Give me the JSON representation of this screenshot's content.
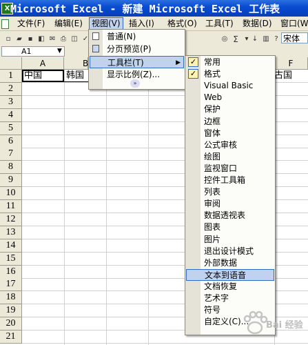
{
  "window": {
    "title": "Microsoft Excel - 新建 Microsoft Excel 工作表",
    "app_icon": "X"
  },
  "menubar": {
    "items": [
      {
        "label": "文件(F)"
      },
      {
        "label": "编辑(E)"
      },
      {
        "label": "视图(V)"
      },
      {
        "label": "插入(I)"
      },
      {
        "label": "格式(O)"
      },
      {
        "label": "工具(T)"
      },
      {
        "label": "数据(D)"
      },
      {
        "label": "窗口(W"
      }
    ]
  },
  "toolbar": {
    "font_name": "宋体",
    "sigma": "Σ"
  },
  "formula_bar": {
    "name_box": "A1"
  },
  "grid": {
    "columns": [
      "A",
      "B",
      "F"
    ],
    "rows": [
      "1",
      "2",
      "3",
      "4",
      "5",
      "6",
      "7",
      "8",
      "9",
      "10",
      "11",
      "12",
      "13",
      "14",
      "15",
      "16",
      "17",
      "18",
      "19",
      "20",
      "21"
    ],
    "cells": {
      "A1": "中国",
      "B1": "韩国",
      "F1": "古国"
    }
  },
  "view_menu": {
    "items": [
      {
        "label": "普通(N)"
      },
      {
        "label": "分页预览(P)"
      },
      {
        "label": "工具栏(T)"
      },
      {
        "label": "显示比例(Z)..."
      }
    ],
    "more": "»"
  },
  "toolbars_menu": {
    "check_mark": "✓",
    "items": [
      {
        "label": "常用",
        "checked": true
      },
      {
        "label": "格式",
        "checked": true
      },
      {
        "label": "Visual Basic",
        "checked": false
      },
      {
        "label": "Web",
        "checked": false
      },
      {
        "label": "保护",
        "checked": false
      },
      {
        "label": "边框",
        "checked": false
      },
      {
        "label": "窗体",
        "checked": false
      },
      {
        "label": "公式审核",
        "checked": false
      },
      {
        "label": "绘图",
        "checked": false
      },
      {
        "label": "监视窗口",
        "checked": false
      },
      {
        "label": "控件工具箱",
        "checked": false
      },
      {
        "label": "列表",
        "checked": false
      },
      {
        "label": "审阅",
        "checked": false
      },
      {
        "label": "数据透视表",
        "checked": false
      },
      {
        "label": "图表",
        "checked": false
      },
      {
        "label": "图片",
        "checked": false
      },
      {
        "label": "退出设计模式",
        "checked": false
      },
      {
        "label": "外部数据",
        "checked": false
      },
      {
        "label": "文本到语音",
        "checked": false,
        "highlighted": true
      },
      {
        "label": "文档恢复",
        "checked": false
      },
      {
        "label": "艺术字",
        "checked": false
      },
      {
        "label": "符号",
        "checked": false
      },
      {
        "label": "自定义(C)...",
        "checked": false
      }
    ]
  },
  "watermark": {
    "text": "Bai 经验"
  },
  "colors": {
    "title_blue": "#0a4cd0",
    "menu_bg": "#ece9d8",
    "highlight": "#c1d2ee",
    "highlight_border": "#316ac5"
  }
}
